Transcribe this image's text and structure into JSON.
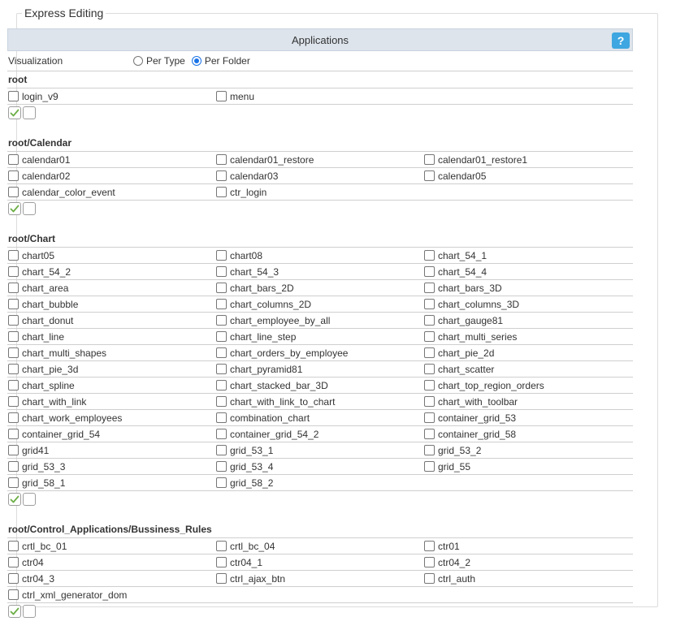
{
  "fieldset": {
    "legend": "Express Editing"
  },
  "header": {
    "title": "Applications",
    "help_label": "?"
  },
  "visualization": {
    "label": "Visualization",
    "options": [
      {
        "label": "Per Type",
        "checked": false
      },
      {
        "label": "Per Folder",
        "checked": true
      }
    ]
  },
  "groups": [
    {
      "title": "root",
      "rows": [
        [
          "login_v9",
          "menu"
        ]
      ]
    },
    {
      "title": "root/Calendar",
      "rows": [
        [
          "calendar01",
          "calendar01_restore",
          "calendar01_restore1"
        ],
        [
          "calendar02",
          "calendar03",
          "calendar05"
        ],
        [
          "calendar_color_event",
          "ctr_login"
        ]
      ]
    },
    {
      "title": "root/Chart",
      "rows": [
        [
          "chart05",
          "chart08",
          "chart_54_1"
        ],
        [
          "chart_54_2",
          "chart_54_3",
          "chart_54_4"
        ],
        [
          "chart_area",
          "chart_bars_2D",
          "chart_bars_3D"
        ],
        [
          "chart_bubble",
          "chart_columns_2D",
          "chart_columns_3D"
        ],
        [
          "chart_donut",
          "chart_employee_by_all",
          "chart_gauge81"
        ],
        [
          "chart_line",
          "chart_line_step",
          "chart_multi_series"
        ],
        [
          "chart_multi_shapes",
          "chart_orders_by_employee",
          "chart_pie_2d"
        ],
        [
          "chart_pie_3d",
          "chart_pyramid81",
          "chart_scatter"
        ],
        [
          "chart_spline",
          "chart_stacked_bar_3D",
          "chart_top_region_orders"
        ],
        [
          "chart_with_link",
          "chart_with_link_to_chart",
          "chart_with_toolbar"
        ],
        [
          "chart_work_employees",
          "combination_chart",
          "container_grid_53"
        ],
        [
          "container_grid_54",
          "container_grid_54_2",
          "container_grid_58"
        ],
        [
          "grid41",
          "grid_53_1",
          "grid_53_2"
        ],
        [
          "grid_53_3",
          "grid_53_4",
          "grid_55"
        ],
        [
          "grid_58_1",
          "grid_58_2"
        ]
      ]
    },
    {
      "title": "root/Control_Applications/Bussiness_Rules",
      "rows": [
        [
          "crtl_bc_01",
          "crtl_bc_04",
          "ctr01"
        ],
        [
          "ctr04",
          "ctr04_1",
          "ctr04_2"
        ],
        [
          "ctr04_3",
          "ctrl_ajax_btn",
          "ctrl_auth"
        ],
        [
          "ctrl_xml_generator_dom"
        ]
      ]
    }
  ]
}
